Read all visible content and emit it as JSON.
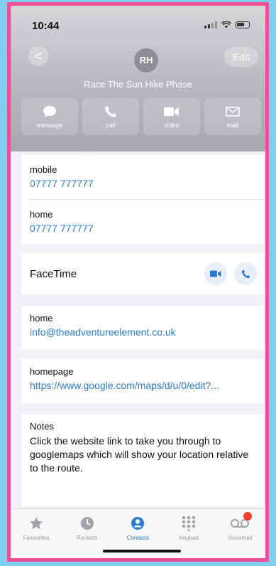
{
  "status": {
    "time": "10:44"
  },
  "header": {
    "back_label": "<",
    "avatar_initials": "RH",
    "edit_label": "Edit",
    "contact_name": "Race The Sun  Hike Phase"
  },
  "actions": [
    {
      "label": "message",
      "icon": "message-icon"
    },
    {
      "label": "call",
      "icon": "phone-icon"
    },
    {
      "label": "video",
      "icon": "video-icon"
    },
    {
      "label": "mail",
      "icon": "mail-icon"
    }
  ],
  "phones": [
    {
      "label": "mobile",
      "value": "07777 777777"
    },
    {
      "label": "home",
      "value": "07777 777777"
    }
  ],
  "facetime": {
    "label": "FaceTime"
  },
  "email": {
    "label": "home",
    "value": "info@theadventureelement.co.uk"
  },
  "homepage": {
    "label": "homepage",
    "value": "https://www.google.com/maps/d/u/0/edit?..."
  },
  "notes": {
    "label": "Notes",
    "text": "Click the website link to take you through to googlemaps which will show your location relative to the route."
  },
  "tabs": [
    {
      "label": "Favourites",
      "icon": "star-icon"
    },
    {
      "label": "Recents",
      "icon": "clock-icon"
    },
    {
      "label": "Contacts",
      "icon": "person-icon",
      "active": true
    },
    {
      "label": "Keypad",
      "icon": "keypad-icon"
    },
    {
      "label": "Voicemail",
      "icon": "voicemail-icon"
    }
  ],
  "colors": {
    "accent": "#2b7bd1",
    "border": "#ec4f95",
    "background": "#7fd0ec",
    "badge": "#f23c2f"
  }
}
